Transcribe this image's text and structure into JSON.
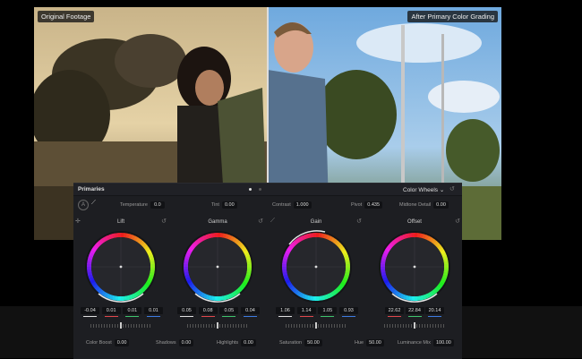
{
  "footage": {
    "left_label": "Original Footage",
    "right_label": "After Primary Color Grading"
  },
  "panel": {
    "title": "Primaries",
    "mode": "Color Wheels",
    "params": [
      {
        "label": "Temperature",
        "value": "0.0"
      },
      {
        "label": "Tint",
        "value": "0.00"
      },
      {
        "label": "Contrast",
        "value": "1.000"
      },
      {
        "label": "Pivot",
        "value": "0.435"
      },
      {
        "label": "Midtone Detail",
        "value": "0.00"
      }
    ],
    "wheels": [
      {
        "label": "Lift",
        "values": [
          "-0.04",
          "0.01",
          "0.01",
          "0.01"
        ]
      },
      {
        "label": "Gamma",
        "values": [
          "0.05",
          "0.08",
          "0.05",
          "0.04"
        ]
      },
      {
        "label": "Gain",
        "values": [
          "1.06",
          "1.14",
          "1.05",
          "0.93"
        ]
      },
      {
        "label": "Offset",
        "values": [
          "22.62",
          "22.84",
          "20.14"
        ]
      }
    ],
    "bottom_params": [
      {
        "label": "Color Boost",
        "value": "0.00"
      },
      {
        "label": "Shadows",
        "value": "0.00"
      },
      {
        "label": "Highlights",
        "value": "0.00"
      },
      {
        "label": "Saturation",
        "value": "50.00"
      },
      {
        "label": "Hue",
        "value": "50.00"
      },
      {
        "label": "Luminance Mix",
        "value": "100.00"
      }
    ]
  },
  "colors": {
    "channel_y": "#e0e0e0",
    "channel_r": "#e0474c",
    "channel_g": "#3ec46d",
    "channel_b": "#3d7be0"
  }
}
